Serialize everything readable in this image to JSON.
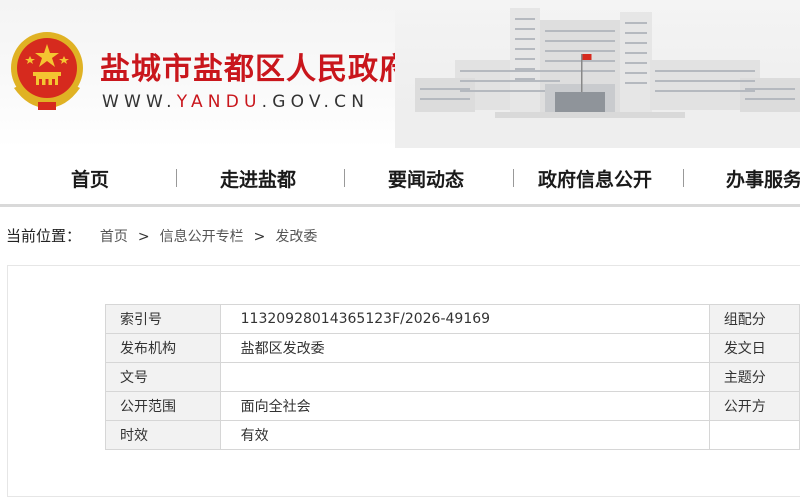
{
  "header": {
    "title": "盐城市盐都区人民政府",
    "domain_prefix": "WWW.",
    "domain_highlight": "YANDU",
    "domain_suffix": ".GOV.CN",
    "emblem_icon": "national-emblem-icon",
    "building_image": "government-building-photo",
    "colors": {
      "title": "#c9161c",
      "text": "#333333"
    }
  },
  "nav": {
    "items": [
      "首页",
      "走进盐都",
      "要闻动态",
      "政府信息公开",
      "办事服务"
    ]
  },
  "breadcrumb": {
    "lead": "当前位置：",
    "items": [
      "首页",
      "信息公开专栏",
      "发改委"
    ],
    "separator": ">"
  },
  "meta": {
    "rows": [
      {
        "label": "索引号",
        "value": "11320928014365123F/2026-49169",
        "label2": "组配分"
      },
      {
        "label": "发布机构",
        "value": "盐都区发改委",
        "label2": "发文日"
      },
      {
        "label": "文号",
        "value": "",
        "label2": "主题分"
      },
      {
        "label": "公开范围",
        "value": "面向全社会",
        "label2": "公开方"
      },
      {
        "label": "时效",
        "value": "有效",
        "label2": ""
      }
    ]
  }
}
